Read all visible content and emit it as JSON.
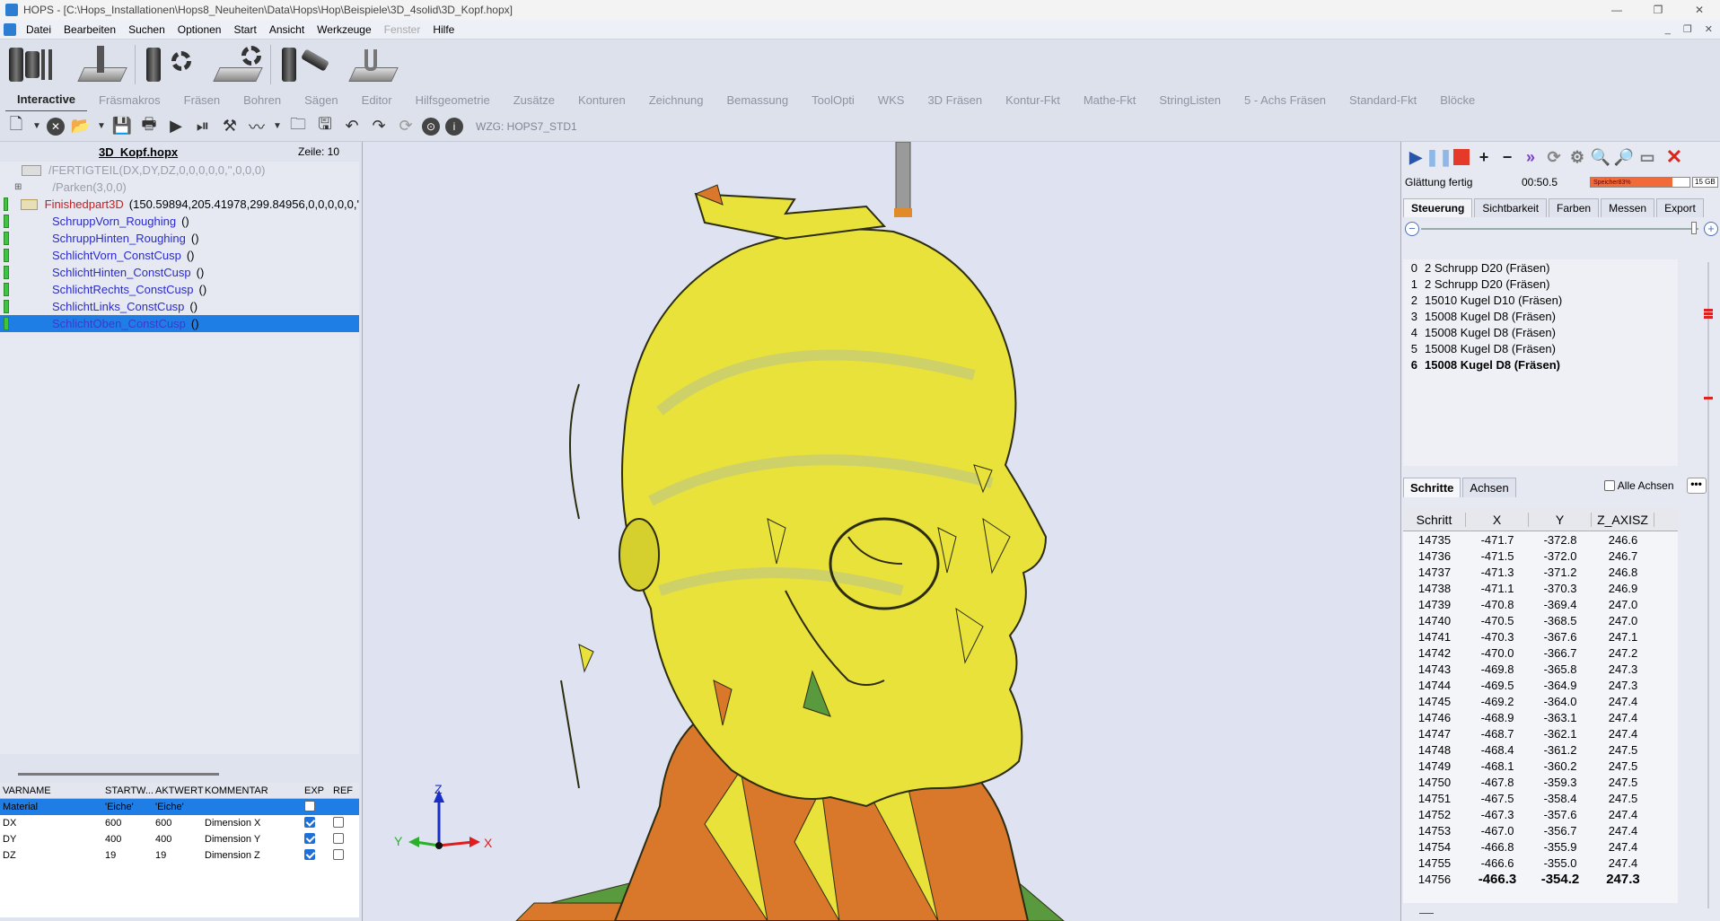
{
  "window": {
    "title": "HOPS - [C:\\Hops_Installationen\\Hops8_Neuheiten\\Data\\Hops\\Hop\\Beispiele\\3D_4solid\\3D_Kopf.hopx]",
    "minimize": "—",
    "restore": "❐",
    "close": "✕"
  },
  "menu": {
    "items": [
      "Datei",
      "Bearbeiten",
      "Suchen",
      "Optionen",
      "Start",
      "Ansicht",
      "Werkzeuge",
      "Fenster",
      "Hilfe"
    ],
    "mdi_min": "_",
    "mdi_restore": "❐",
    "mdi_close": "✕"
  },
  "tabs": [
    "Interactive",
    "Fräsmakros",
    "Fräsen",
    "Bohren",
    "Sägen",
    "Editor",
    "Hilfsgeometrie",
    "Zusätze",
    "Konturen",
    "Zeichnung",
    "Bemassung",
    "ToolOpti",
    "WKS",
    "3D Fräsen",
    "Kontur-Fkt",
    "Mathe-Fkt",
    "StringListen",
    "5 - Achs Fräsen",
    "Standard-Fkt",
    "Blöcke"
  ],
  "toolbar": {
    "wzg": "WZG: HOPS7_STD1"
  },
  "left": {
    "filename": "3D_Kopf.hopx",
    "zeile": "Zeile: 10",
    "tree": [
      {
        "name": "/FERTIGTEIL(DX,DY,DZ,0,0,0,0,0,'',0,0,0)",
        "args": ""
      },
      {
        "name": "/Parken(3,0,0)",
        "args": ""
      },
      {
        "name": "Finishedpart3D",
        "args": "(150.59894,205.41978,299.84956,0,0,0,0,0,'"
      },
      {
        "name": "SchruppVorn_Roughing",
        "args": "()"
      },
      {
        "name": "SchruppHinten_Roughing",
        "args": "()"
      },
      {
        "name": "SchlichtVorn_ConstCusp",
        "args": "()"
      },
      {
        "name": "SchlichtHinten_ConstCusp",
        "args": "()"
      },
      {
        "name": "SchlichtRechts_ConstCusp",
        "args": "()"
      },
      {
        "name": "SchlichtLinks_ConstCusp",
        "args": "()"
      },
      {
        "name": "SchlichtOben_ConstCusp",
        "args": "()"
      }
    ],
    "vartable": {
      "headers": [
        "VARNAME",
        "STARTW...",
        "AKTWERT",
        "KOMMENTAR",
        "EXP",
        "REF"
      ],
      "rows": [
        {
          "name": "Material",
          "start": "'Eiche'",
          "akt": "'Eiche'",
          "comment": "",
          "exp": false,
          "ref": null
        },
        {
          "name": "DX",
          "start": "600",
          "akt": "600",
          "comment": "Dimension X",
          "exp": true,
          "ref": false
        },
        {
          "name": "DY",
          "start": "400",
          "akt": "400",
          "comment": "Dimension Y",
          "exp": true,
          "ref": false
        },
        {
          "name": "DZ",
          "start": "19",
          "akt": "19",
          "comment": "Dimension Z",
          "exp": true,
          "ref": false
        }
      ]
    }
  },
  "viewport": {
    "axes": {
      "x": "X",
      "y": "Y",
      "z": "Z"
    },
    "colors": {
      "head": "#e8e23a",
      "edge": "#2c2c10",
      "orange": "#d9772b",
      "green": "#5a9a3e",
      "blue": "#1a2ec8",
      "red": "#e01c1c",
      "ygreen": "#2ab02a"
    }
  },
  "right": {
    "status": "Glättung fertig",
    "time": "00:50.5",
    "memory_label": "Speicher83%",
    "memory_fraction": 0.83,
    "memory_size": "15 GB",
    "tabs": [
      "Steuerung",
      "Sichtbarkeit",
      "Farben",
      "Messen",
      "Export"
    ],
    "tools": [
      {
        "idx": "0",
        "name": "2 Schrupp D20 (Fräsen)"
      },
      {
        "idx": "1",
        "name": "2 Schrupp D20 (Fräsen)"
      },
      {
        "idx": "2",
        "name": "15010 Kugel D10 (Fräsen)"
      },
      {
        "idx": "3",
        "name": "15008 Kugel D8 (Fräsen)"
      },
      {
        "idx": "4",
        "name": "15008 Kugel D8 (Fräsen)"
      },
      {
        "idx": "5",
        "name": "15008 Kugel D8 (Fräsen)"
      },
      {
        "idx": "6",
        "name": "15008 Kugel D8 (Fräsen)"
      }
    ],
    "steptabs": [
      "Schritte",
      "Achsen"
    ],
    "alle_achsen": "Alle Achsen",
    "dots": "•••",
    "steps_headers": [
      "Schritt",
      "X",
      "Y",
      "Z_AXISZ"
    ],
    "steps": [
      [
        "14735",
        "-471.7",
        "-372.8",
        "246.6"
      ],
      [
        "14736",
        "-471.5",
        "-372.0",
        "246.7"
      ],
      [
        "14737",
        "-471.3",
        "-371.2",
        "246.8"
      ],
      [
        "14738",
        "-471.1",
        "-370.3",
        "246.9"
      ],
      [
        "14739",
        "-470.8",
        "-369.4",
        "247.0"
      ],
      [
        "14740",
        "-470.5",
        "-368.5",
        "247.0"
      ],
      [
        "14741",
        "-470.3",
        "-367.6",
        "247.1"
      ],
      [
        "14742",
        "-470.0",
        "-366.7",
        "247.2"
      ],
      [
        "14743",
        "-469.8",
        "-365.8",
        "247.3"
      ],
      [
        "14744",
        "-469.5",
        "-364.9",
        "247.3"
      ],
      [
        "14745",
        "-469.2",
        "-364.0",
        "247.4"
      ],
      [
        "14746",
        "-468.9",
        "-363.1",
        "247.4"
      ],
      [
        "14747",
        "-468.7",
        "-362.1",
        "247.4"
      ],
      [
        "14748",
        "-468.4",
        "-361.2",
        "247.5"
      ],
      [
        "14749",
        "-468.1",
        "-360.2",
        "247.5"
      ],
      [
        "14750",
        "-467.8",
        "-359.3",
        "247.5"
      ],
      [
        "14751",
        "-467.5",
        "-358.4",
        "247.5"
      ],
      [
        "14752",
        "-467.3",
        "-357.6",
        "247.4"
      ],
      [
        "14753",
        "-467.0",
        "-356.7",
        "247.4"
      ],
      [
        "14754",
        "-466.8",
        "-355.9",
        "247.4"
      ],
      [
        "14755",
        "-466.6",
        "-355.0",
        "247.4"
      ],
      [
        "14756",
        "-466.3",
        "-354.2",
        "247.3"
      ]
    ]
  }
}
